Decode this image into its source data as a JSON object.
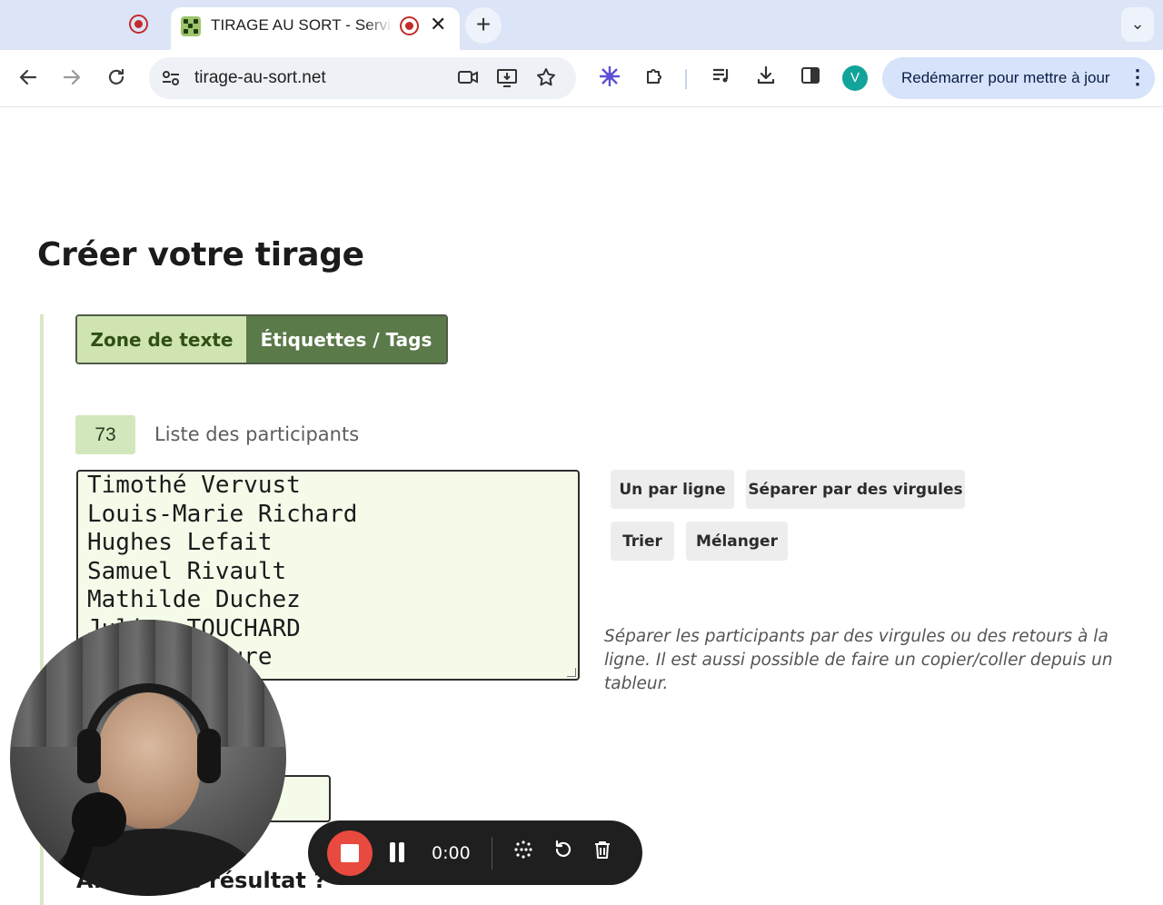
{
  "browser": {
    "tab": {
      "title": "TIRAGE AU SORT - Service",
      "close_glyph": "✕"
    },
    "new_tab_glyph": "+",
    "tab_menu_glyph": "⌄",
    "url": "tirage-au-sort.net",
    "avatar_letter": "V",
    "update_button": "Redémarrer pour mettre à jour",
    "icons": {
      "back": "back-arrow-icon",
      "forward": "forward-arrow-icon",
      "reload": "reload-icon",
      "site_settings": "tune-icon",
      "camera": "video-camera-icon",
      "install": "install-app-icon",
      "bookmark": "star-icon",
      "extension_perplexity": "perplexity-icon",
      "extensions": "puzzle-icon",
      "media": "media-queue-icon",
      "downloads": "download-icon",
      "side_panel": "side-panel-icon",
      "menu": "kebab-menu-icon"
    }
  },
  "page": {
    "title": "Créer votre tirage",
    "mode_tabs": [
      {
        "label": "Zone de texte",
        "active": false
      },
      {
        "label": "Étiquettes / Tags",
        "active": true
      }
    ],
    "participants": {
      "count": "73",
      "label": "Liste des participants",
      "lines": [
        "Timothé Vervust",
        "Louis-Marie Richard",
        "Hughes Lefait",
        "Samuel Rivault",
        "Mathilde Duchez",
        "Julien TOUCHARD",
        "Julie Maujure"
      ]
    },
    "actions": {
      "one_per_line": "Un par ligne",
      "comma_separated": "Séparer par des virgules",
      "sort": "Trier",
      "shuffle": "Mélanger"
    },
    "help_text": "Séparer les participants par des virgules ou des retours à la ligne. Il est aussi possible de faire un copier/coller depuis un tableur.",
    "bottom_heading": "Afficher le résultat ?"
  },
  "recorder": {
    "time": "0:00",
    "icons": [
      "stop-icon",
      "pause-icon",
      "grid-dots-icon",
      "restart-icon",
      "trash-icon"
    ]
  },
  "colors": {
    "accent_green": "#5a7a49",
    "light_green": "#cfe4b1",
    "textarea_bg": "#f4fbe9",
    "record_red": "#e84a3f"
  }
}
